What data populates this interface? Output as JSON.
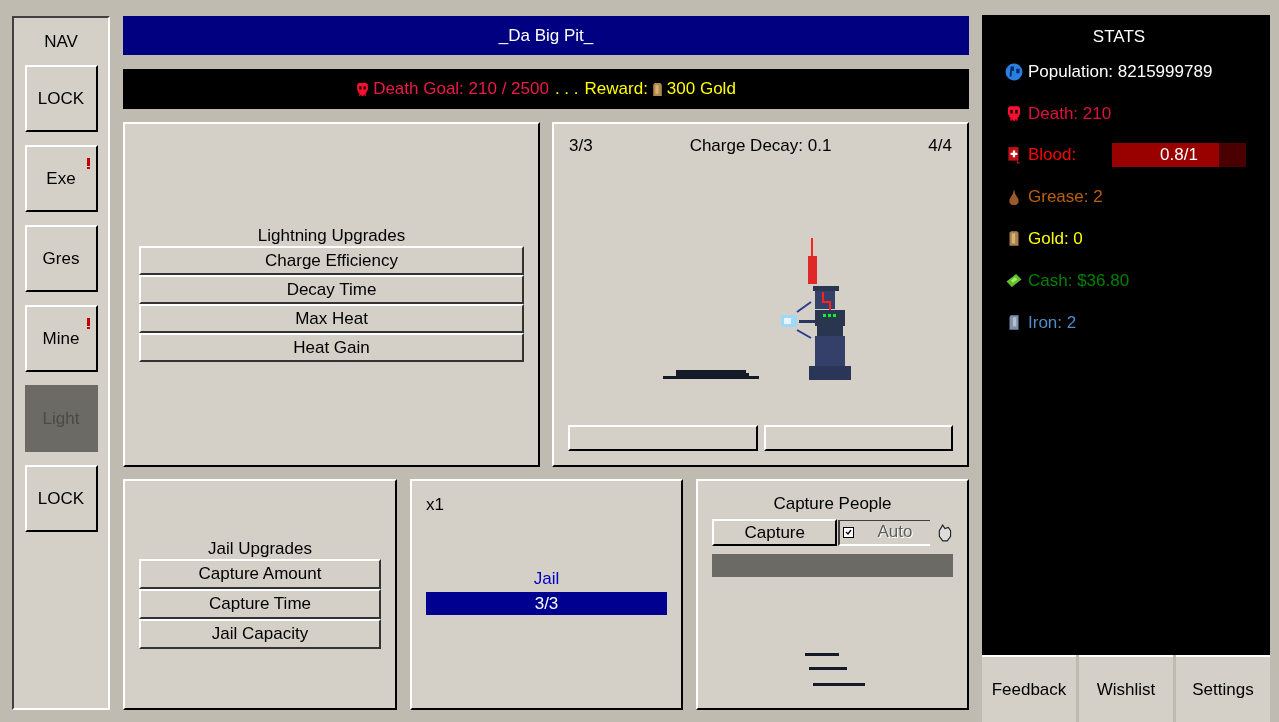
{
  "nav": {
    "title": "NAV",
    "items": [
      {
        "label": "LOCK",
        "selected": false,
        "alert": false
      },
      {
        "label": "Exe",
        "selected": false,
        "alert": true
      },
      {
        "label": "Gres",
        "selected": false,
        "alert": false
      },
      {
        "label": "Mine",
        "selected": false,
        "alert": true
      },
      {
        "label": "Light",
        "selected": true,
        "alert": false
      },
      {
        "label": "LOCK",
        "selected": false,
        "alert": false
      }
    ]
  },
  "header": {
    "title": "_Da Big Pit_"
  },
  "goal": {
    "death_goal": "Death Goal: 210 / 2500",
    "separator": ". . .",
    "reward_label": "Reward:",
    "reward": "300 Gold"
  },
  "lightning_upgrades": {
    "title": "Lightning Upgrades",
    "items": [
      "Charge Efficiency",
      "Decay Time",
      "Max Heat",
      "Heat Gain"
    ]
  },
  "lightning": {
    "left_count": "3/3",
    "charge_decay": "Charge Decay: 0.1",
    "right_count": "4/4"
  },
  "jail_upgrades": {
    "title": "Jail Upgrades",
    "items": [
      "Capture Amount",
      "Capture Time",
      "Jail Capacity"
    ]
  },
  "jail": {
    "multiplier": "x1",
    "label": "Jail",
    "reading": "3/3",
    "level": 1
  },
  "capture": {
    "title": "Capture People",
    "button": "Capture",
    "auto": {
      "label": "Auto",
      "checked": true
    },
    "level": 0
  },
  "stats": {
    "title": "STATS",
    "items": [
      {
        "kind": "text",
        "label": "Population: 8215999789",
        "color": "#ffffff"
      },
      {
        "kind": "text",
        "label": "Death: 210",
        "color": "#e0103c"
      },
      {
        "kind": "bar",
        "label": "Blood:",
        "color": "#ff0000",
        "level": 0.8,
        "reading": "0.8/1"
      },
      {
        "kind": "text",
        "label": "Grease: 2",
        "color": "#b8600a"
      },
      {
        "kind": "text",
        "label": "Gold: 0",
        "color": "#ffff00"
      },
      {
        "kind": "text",
        "label": "Cash: $36.80",
        "color": "#008000"
      },
      {
        "kind": "text",
        "label": "Iron: 2",
        "color": "#4f8cc8"
      }
    ]
  },
  "footer": [
    "Feedback",
    "Wishlist",
    "Settings"
  ]
}
